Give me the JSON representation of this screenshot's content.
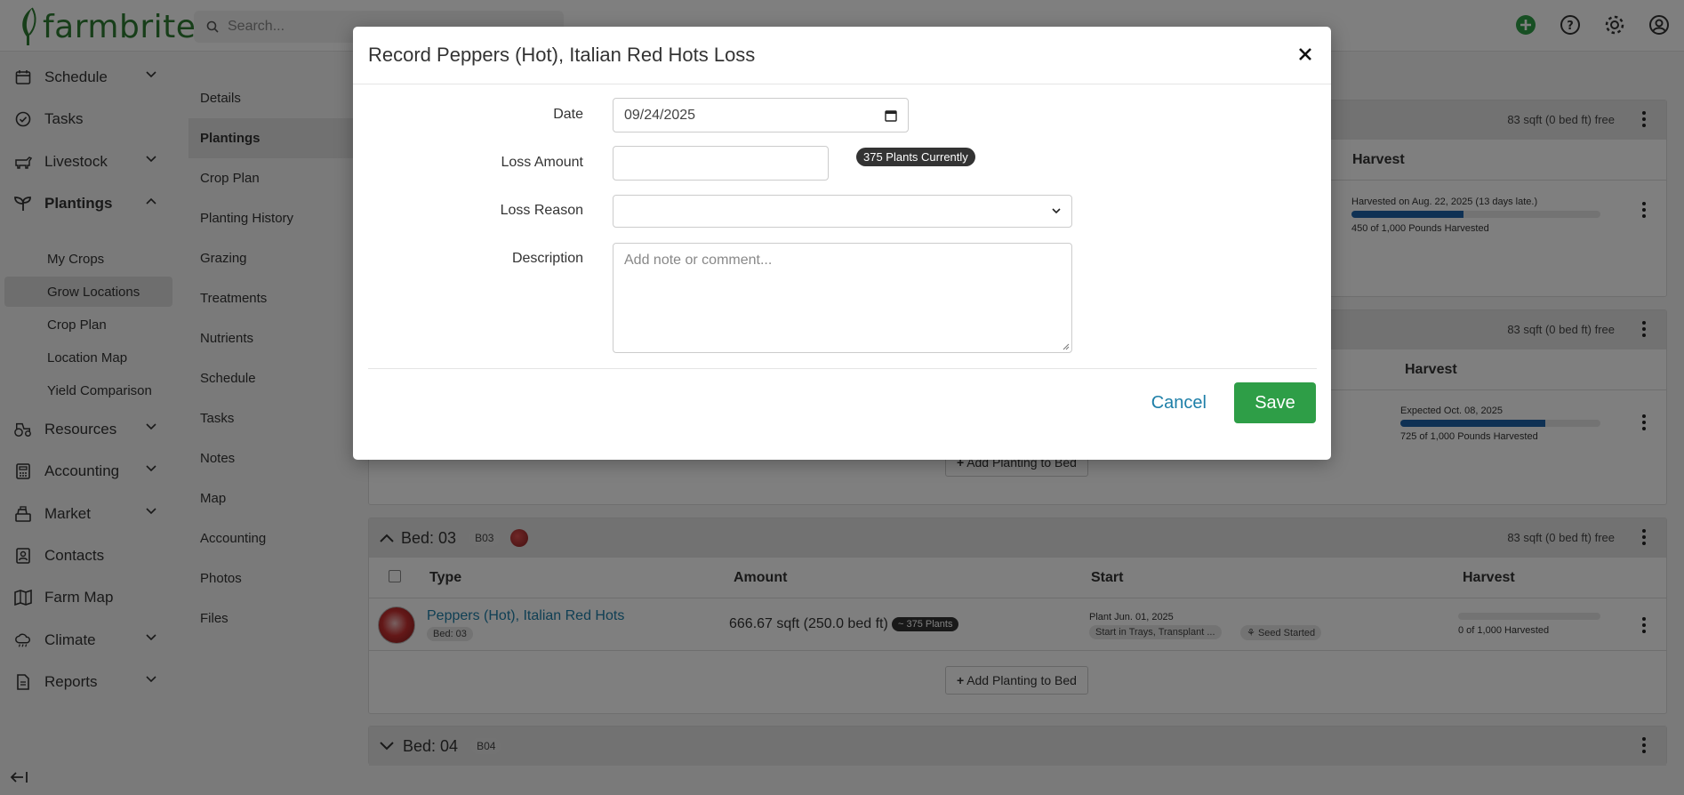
{
  "app": {
    "logo_text": "farmbrite"
  },
  "search": {
    "placeholder": "Search..."
  },
  "sidebar": {
    "items": [
      {
        "label": "Schedule"
      },
      {
        "label": "Tasks"
      },
      {
        "label": "Livestock"
      },
      {
        "label": "Plantings"
      },
      {
        "label": "Resources"
      },
      {
        "label": "Accounting"
      },
      {
        "label": "Market"
      },
      {
        "label": "Contacts"
      },
      {
        "label": "Farm Map"
      },
      {
        "label": "Climate"
      },
      {
        "label": "Reports"
      }
    ],
    "subitems": [
      {
        "label": "My Crops"
      },
      {
        "label": "Grow Locations"
      },
      {
        "label": "Crop Plan"
      },
      {
        "label": "Location Map"
      },
      {
        "label": "Yield Comparison"
      }
    ]
  },
  "subnav": {
    "items": [
      {
        "label": "Details"
      },
      {
        "label": "Plantings"
      },
      {
        "label": "Crop Plan"
      },
      {
        "label": "Planting History"
      },
      {
        "label": "Grazing"
      },
      {
        "label": "Treatments"
      },
      {
        "label": "Nutrients"
      },
      {
        "label": "Schedule"
      },
      {
        "label": "Tasks"
      },
      {
        "label": "Notes"
      },
      {
        "label": "Map"
      },
      {
        "label": "Accounting"
      },
      {
        "label": "Photos"
      },
      {
        "label": "Files"
      }
    ]
  },
  "beds": {
    "bed1": {
      "free": "83 sqft (0 bed ft) free",
      "harvest_header": "Harvest",
      "harvest_note": "Harvested on Aug. 22, 2025 (13 days late.)",
      "harvest_progress": 0.45,
      "harvest_label": "450 of 1,000 Pounds Harvested"
    },
    "bed2": {
      "free": "83 sqft (0 bed ft) free",
      "harvest_header": "Harvest",
      "harvest_note": "Expected Oct. 08, 2025",
      "harvest_progress": 0.725,
      "harvest_label": "725 of 1,000 Pounds Harvested",
      "add_label": "Add Planting to Bed"
    },
    "bed3": {
      "title": "Bed: 03",
      "code": "B03",
      "free": "83 sqft (0 bed ft) free",
      "columns": {
        "type": "Type",
        "amount": "Amount",
        "start": "Start",
        "harvest": "Harvest"
      },
      "row": {
        "crop": "Peppers (Hot), Italian Red Hots",
        "bed_tag": "Bed: 03",
        "amount": "666.67 sqft (250.0 bed ft)",
        "plants": "~ 375 Plants",
        "start_date": "Plant Jun. 01, 2025",
        "start_method": "Start in Trays, Transplant ...",
        "seed_status": "Seed Started",
        "harvest_progress": 0,
        "harvest_label": "0 of 1,000 Harvested"
      },
      "add_label": "Add Planting to Bed"
    },
    "bed4": {
      "title": "Bed: 04",
      "code": "B04"
    }
  },
  "modal": {
    "title": "Record Peppers (Hot), Italian Red Hots Loss",
    "date_label": "Date",
    "date_value": "09/24/2025",
    "loss_amount_label": "Loss Amount",
    "loss_amount_value": "",
    "plants_badge": "375 Plants Currently",
    "loss_reason_label": "Loss Reason",
    "loss_reason_value": "",
    "description_label": "Description",
    "description_placeholder": "Add note or comment...",
    "cancel_label": "Cancel",
    "save_label": "Save"
  },
  "colors": {
    "brand_green": "#2e7d32",
    "save_green": "#2e9e47",
    "link_blue": "#1e7fa8",
    "progress_blue": "#1e63a8"
  }
}
